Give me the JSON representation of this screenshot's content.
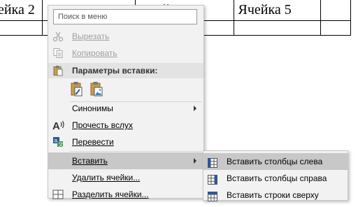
{
  "table": {
    "cells": [
      "ейка 2",
      "",
      "",
      "Ячейка 4",
      "Ячейка 5",
      ""
    ]
  },
  "menu": {
    "search_placeholder": "Поиск в меню",
    "cut": "Вырезать",
    "copy": "Копировать",
    "paste_options": "Параметры вставки:",
    "synonyms": "Синонимы",
    "read_aloud": "Прочесть вслух",
    "translate": "Перевести",
    "insert": "Вставить",
    "delete_cells": "Удалить ячейки...",
    "split_cells": "Разделить ячейки..."
  },
  "submenu": {
    "insert_cols_left": "Вставить столбцы слева",
    "insert_cols_right": "Вставить столбцы справа",
    "insert_rows_above": "Вставить строки сверху"
  },
  "colors": {
    "menu_bg": "#f2f2f2",
    "highlight": "#c8c8c8",
    "icon_blue": "#2b579a"
  }
}
